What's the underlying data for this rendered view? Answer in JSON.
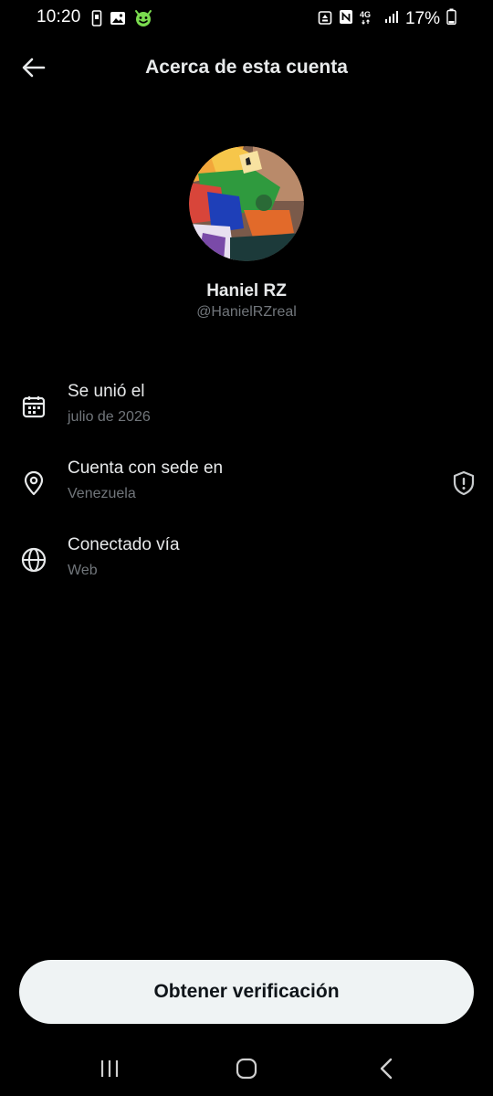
{
  "status_bar": {
    "time": "10:20",
    "battery": "17%",
    "left_icons": [
      "phone-icon",
      "image-icon",
      "android-face-icon"
    ],
    "right_icons": [
      "alarm-icon",
      "nfc-icon",
      "4g-icon",
      "signal-icon",
      "battery-icon"
    ]
  },
  "header": {
    "back_icon": "arrow-left-icon",
    "title": "Acerca de esta cuenta"
  },
  "profile": {
    "display_name": "Haniel RZ",
    "handle": "@HanielRZreal"
  },
  "info": [
    {
      "icon": "calendar-icon",
      "title": "Se unió el",
      "value": "julio de 2026"
    },
    {
      "icon": "location-pin-icon",
      "title": "Cuenta con sede en",
      "value": "Venezuela",
      "side_icon": "shield-alert-icon"
    },
    {
      "icon": "globe-icon",
      "title": "Conectado vía",
      "value": "Web"
    }
  ],
  "actions": {
    "verify_label": "Obtener verificación"
  },
  "nav_bar": {
    "icons": [
      "recent-apps-icon",
      "home-icon",
      "back-icon"
    ]
  },
  "colors": {
    "background": "#000000",
    "primary_text": "#e7e9ea",
    "secondary_text": "#71767b",
    "button_bg": "#eff3f4",
    "button_text": "#0f1419"
  }
}
